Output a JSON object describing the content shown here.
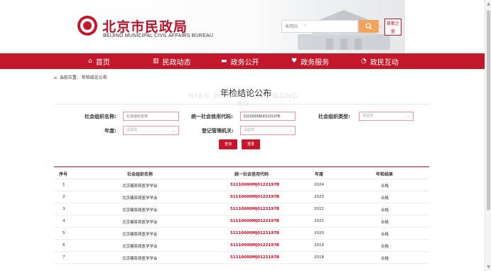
{
  "header": {
    "site_name_cn": "北京市民政局",
    "site_name_en": "BEIJING MUNICIPAL CIVIL AFFAIRS BUREAU",
    "search_scope": "本网站",
    "seal_text": "首都之窗"
  },
  "nav": {
    "items": [
      {
        "label": "首页",
        "icon": "home-icon"
      },
      {
        "label": "民政动态",
        "icon": "building-icon"
      },
      {
        "label": "政务公开",
        "icon": "monitor-icon"
      },
      {
        "label": "政务服务",
        "icon": "heart-icon"
      },
      {
        "label": "政民互动",
        "icon": "chat-icon"
      }
    ]
  },
  "breadcrumb": {
    "prefix": "当前位置:",
    "current": "年检结论公布"
  },
  "page": {
    "title": "年检结论公布",
    "title_pinyin": "NIAN JIAN JIE LUN GONG BU"
  },
  "form": {
    "org_name_label": "社会组织名称:",
    "org_name_placeholder": "社会组织名称",
    "credit_code_label": "统一社会信用代码:",
    "credit_code_value": "51110000MJ0122197B",
    "org_type_label": "社会组织类型:",
    "org_type_placeholder": "请选择",
    "year_label": "年度:",
    "year_placeholder": "请选择",
    "authority_label": "登记管理机关:",
    "authority_placeholder": "请选择",
    "query_button": "查询",
    "reset_button": "重置"
  },
  "table": {
    "headers": [
      "序号",
      "社会组织名称",
      "统一社会信用代码",
      "年度",
      "年检结果"
    ],
    "rows": [
      {
        "no": "1",
        "name": "北京糖尿病医学学会",
        "code": "51110000MJ0122197B",
        "year": "2024",
        "result": "合格"
      },
      {
        "no": "2",
        "name": "北京糖尿病医学学会",
        "code": "51110000MJ0122197B",
        "year": "2023",
        "result": "合格"
      },
      {
        "no": "3",
        "name": "北京糖尿病医学学会",
        "code": "51110000MJ0122197B",
        "year": "2022",
        "result": "合格"
      },
      {
        "no": "4",
        "name": "北京糖尿病医学学会",
        "code": "51110000MJ0122197B",
        "year": "2021",
        "result": "合格"
      },
      {
        "no": "5",
        "name": "北京糖尿病医学学会",
        "code": "51110000MJ0122197B",
        "year": "2020",
        "result": "合格"
      },
      {
        "no": "6",
        "name": "北京糖尿病医学学会",
        "code": "51110000MJ0122197B",
        "year": "2019",
        "result": "合格"
      },
      {
        "no": "7",
        "name": "北京糖尿病医学学会",
        "code": "51110000MJ0122197B",
        "year": "2018",
        "result": "合格"
      }
    ]
  },
  "colors": {
    "brand_red": "#c3182b",
    "code_red": "#d9001b",
    "search_orange": "#f3a45c"
  }
}
